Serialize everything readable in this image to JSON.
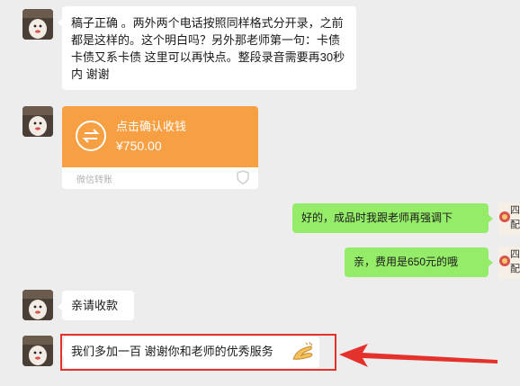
{
  "messages": {
    "m1_text": "稿子正确 。两外两个电话按照同样格式分开录，之前都是这样的。这个明白吗？另外那老师第一句：卡债卡债又系卡债 这里可以再快点。整段录音需要再30秒内 谢谢",
    "transfer": {
      "title": "点击确认收钱",
      "amount": "¥750.00",
      "footer": "微信转账",
      "color": "#f7a043"
    },
    "m3_text": "好的，成品时我跟老师再强调下",
    "m4_text": "亲，费用是650元的哦",
    "m5_text": "亲请收款",
    "m6_text": "我们多加一百 谢谢你和老师的优秀服务"
  },
  "side": {
    "r1a": "四",
    "r1b": "配",
    "r2a": "四",
    "r2b": "配"
  },
  "colors": {
    "sent_bubble": "#95ec69",
    "received_bubble": "#ffffff",
    "background": "#ededed",
    "highlight": "#e4312b"
  },
  "icons": {
    "transfer": "transfer-arrows-icon",
    "clap": "clap-emoji-icon",
    "arrow": "red-arrow"
  }
}
